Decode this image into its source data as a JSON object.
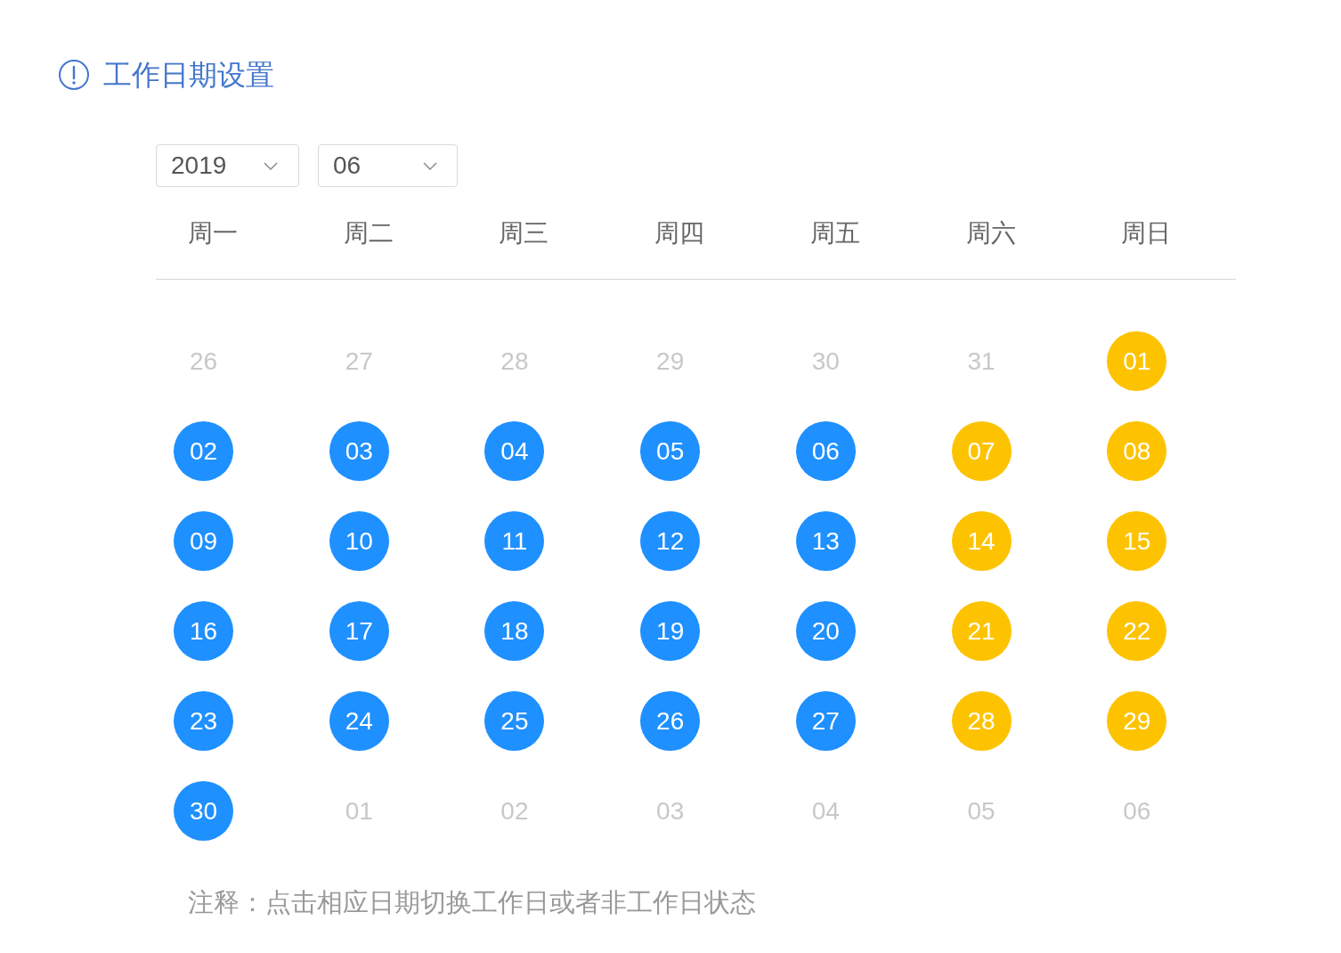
{
  "header": {
    "title": "工作日期设置"
  },
  "filters": {
    "year": {
      "value": "2019"
    },
    "month": {
      "value": "06"
    }
  },
  "calendar": {
    "weekdays": [
      "周一",
      "周二",
      "周三",
      "周四",
      "周五",
      "周六",
      "周日"
    ],
    "weeks": [
      {
        "days": [
          {
            "day": "26",
            "kind": "other_month"
          },
          {
            "day": "27",
            "kind": "other_month"
          },
          {
            "day": "28",
            "kind": "other_month"
          },
          {
            "day": "29",
            "kind": "other_month"
          },
          {
            "day": "30",
            "kind": "other_month"
          },
          {
            "day": "31",
            "kind": "other_month"
          },
          {
            "day": "01",
            "kind": "rest_day"
          }
        ]
      },
      {
        "days": [
          {
            "day": "02",
            "kind": "workday"
          },
          {
            "day": "03",
            "kind": "workday"
          },
          {
            "day": "04",
            "kind": "workday"
          },
          {
            "day": "05",
            "kind": "workday"
          },
          {
            "day": "06",
            "kind": "workday"
          },
          {
            "day": "07",
            "kind": "rest_day"
          },
          {
            "day": "08",
            "kind": "rest_day"
          }
        ]
      },
      {
        "days": [
          {
            "day": "09",
            "kind": "workday"
          },
          {
            "day": "10",
            "kind": "workday"
          },
          {
            "day": "11",
            "kind": "workday"
          },
          {
            "day": "12",
            "kind": "workday"
          },
          {
            "day": "13",
            "kind": "workday"
          },
          {
            "day": "14",
            "kind": "rest_day"
          },
          {
            "day": "15",
            "kind": "rest_day"
          }
        ]
      },
      {
        "days": [
          {
            "day": "16",
            "kind": "workday"
          },
          {
            "day": "17",
            "kind": "workday"
          },
          {
            "day": "18",
            "kind": "workday"
          },
          {
            "day": "19",
            "kind": "workday"
          },
          {
            "day": "20",
            "kind": "workday"
          },
          {
            "day": "21",
            "kind": "rest_day"
          },
          {
            "day": "22",
            "kind": "rest_day"
          }
        ]
      },
      {
        "days": [
          {
            "day": "23",
            "kind": "workday"
          },
          {
            "day": "24",
            "kind": "workday"
          },
          {
            "day": "25",
            "kind": "workday"
          },
          {
            "day": "26",
            "kind": "workday"
          },
          {
            "day": "27",
            "kind": "workday"
          },
          {
            "day": "28",
            "kind": "rest_day"
          },
          {
            "day": "29",
            "kind": "rest_day"
          }
        ]
      },
      {
        "days": [
          {
            "day": "30",
            "kind": "workday"
          },
          {
            "day": "01",
            "kind": "other_month"
          },
          {
            "day": "02",
            "kind": "other_month"
          },
          {
            "day": "03",
            "kind": "other_month"
          },
          {
            "day": "04",
            "kind": "other_month"
          },
          {
            "day": "05",
            "kind": "other_month"
          },
          {
            "day": "06",
            "kind": "other_month"
          }
        ]
      }
    ]
  },
  "note": "注释：点击相应日期切换工作日或者非工作日状态"
}
